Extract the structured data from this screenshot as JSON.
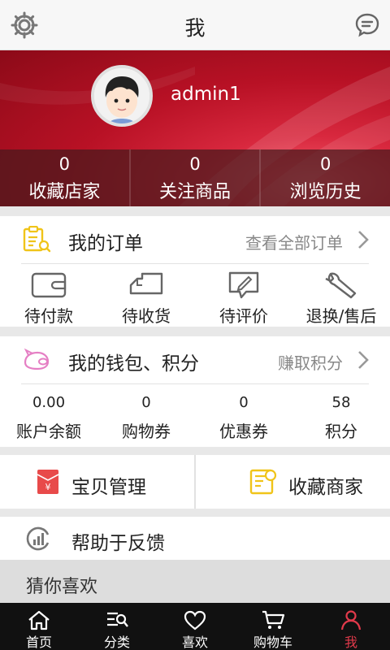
{
  "header": {
    "title": "我"
  },
  "profile": {
    "username": "admin1"
  },
  "stats": [
    {
      "value": "0",
      "label": "收藏店家"
    },
    {
      "value": "0",
      "label": "关注商品"
    },
    {
      "value": "0",
      "label": "浏览历史"
    }
  ],
  "orders": {
    "title": "我的订单",
    "view_all": "查看全部订单",
    "items": [
      {
        "label": "待付款",
        "icon": "wallet-icon"
      },
      {
        "label": "待收货",
        "icon": "truck-icon"
      },
      {
        "label": "待评价",
        "icon": "review-icon"
      },
      {
        "label": "退换/售后",
        "icon": "wrench-icon"
      }
    ]
  },
  "wallet": {
    "title": "我的钱包、积分",
    "earn": "赚取积分",
    "items": [
      {
        "value": "0.00",
        "label": "账户余额"
      },
      {
        "value": "0",
        "label": "购物券"
      },
      {
        "value": "0",
        "label": "优惠券"
      },
      {
        "value": "58",
        "label": "积分"
      }
    ]
  },
  "tools": {
    "products": "宝贝管理",
    "favorites": "收藏商家"
  },
  "help": {
    "label": "帮助于反馈"
  },
  "guess": {
    "label": "猜你喜欢"
  },
  "tabs": [
    {
      "label": "首页",
      "icon": "home-icon"
    },
    {
      "label": "分类",
      "icon": "category-icon"
    },
    {
      "label": "喜欢",
      "icon": "heart-icon"
    },
    {
      "label": "购物车",
      "icon": "cart-icon"
    },
    {
      "label": "我",
      "icon": "user-icon",
      "active": true
    }
  ],
  "colors": {
    "brand_red": "#c8182c",
    "active_tab": "#e23a4b",
    "accent_yellow": "#f0c419",
    "accent_pink": "#e57fc4"
  }
}
